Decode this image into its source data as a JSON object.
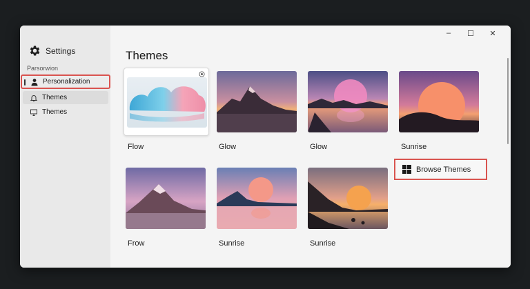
{
  "window": {
    "title": "Settings",
    "controls": {
      "minimize": "–",
      "maximize": "☐",
      "close": "✕"
    }
  },
  "sidebar": {
    "section_label": "Parsorwion",
    "items": [
      {
        "label": "Personalization",
        "icon": "person-icon",
        "selected": true,
        "highlighted": true
      },
      {
        "label": "Themes",
        "icon": "bell-icon",
        "selected": false
      },
      {
        "label": "Themes",
        "icon": "monitor-icon",
        "selected": false
      }
    ]
  },
  "main": {
    "title": "Themes",
    "themes": [
      {
        "label": "Flow",
        "style": "flow",
        "current": true
      },
      {
        "label": "Glow",
        "style": "mountain-dusk"
      },
      {
        "label": "Glow",
        "style": "lake-sunset"
      },
      {
        "label": "Sunrise",
        "style": "hill-sun"
      },
      {
        "label": "Frow",
        "style": "peak-purple"
      },
      {
        "label": "Sunrise",
        "style": "lake-sun"
      },
      {
        "label": "Sunrise",
        "style": "coast-sun"
      }
    ],
    "browse_button": {
      "label": "Browse Themes",
      "icon": "windows-logo-icon",
      "highlighted": true
    }
  },
  "colors": {
    "highlight_border": "#d9534f",
    "sidebar_bg": "#e9e9e9",
    "main_bg": "#f4f4f4"
  }
}
